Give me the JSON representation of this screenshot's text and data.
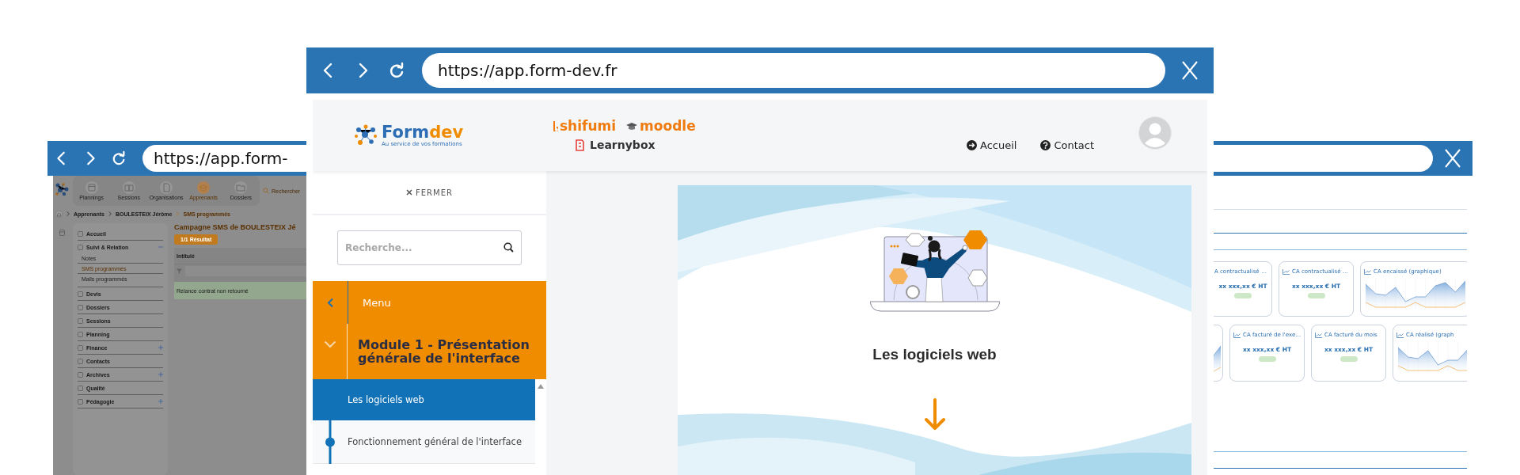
{
  "back_window": {
    "url": "https://app.form-",
    "app": {
      "toolbar": [
        {
          "label": "Plannings",
          "selected": false
        },
        {
          "label": "Sessions",
          "selected": false
        },
        {
          "label": "Organisations",
          "selected": false
        },
        {
          "label": "Apprenants",
          "selected": true
        },
        {
          "label": "Dossiers",
          "selected": false
        }
      ],
      "search": {
        "placeholder": "Rechercher"
      },
      "breadcrumb": [
        "Apprenants",
        "BOULESTEIX Jérôme",
        "SMS programmés"
      ],
      "menu": [
        {
          "label": "Accueil"
        },
        {
          "label": "Suivi & Relation",
          "expanded": true,
          "children": [
            {
              "label": "Notes",
              "selected": false
            },
            {
              "label": "SMS programmés",
              "selected": true
            },
            {
              "label": "Mails programmés",
              "selected": false
            }
          ]
        },
        {
          "label": "Devis"
        },
        {
          "label": "Dossiers"
        },
        {
          "label": "Sessions"
        },
        {
          "label": "Planning"
        },
        {
          "label": "Finance",
          "expanded": false
        },
        {
          "label": "Contacts"
        },
        {
          "label": "Archives",
          "expanded": false
        },
        {
          "label": "Qualité"
        },
        {
          "label": "Pédagogie",
          "expanded": false
        }
      ],
      "title": "Campagne SMS de BOULESTEIX Jé",
      "result_button": "1/1 Résultat",
      "table": {
        "columns": [
          "Intitulé"
        ],
        "rows": [
          [
            "Relance contrat non retourné"
          ]
        ]
      }
    },
    "dashboard": {
      "card_strips": [
        {
          "cards": [
            {
              "kind": "stat",
              "title": "A contractualisé …",
              "value": "xx xxx,xx € HT"
            },
            {
              "kind": "stat",
              "title": "CA contractualisé …",
              "value": "xx xxx,xx € HT"
            },
            {
              "kind": "chart",
              "title": "CA encaissé (graphique)"
            }
          ]
        },
        {
          "cards": [
            {
              "kind": "chart"
            },
            {
              "kind": "stat",
              "title": "CA facturé de l'exe…",
              "value": "xx xxx,xx € HT"
            },
            {
              "kind": "stat",
              "title": "CA facturé du mois",
              "value": "xx xxx,xx € HT"
            },
            {
              "kind": "chart",
              "title": "CA réalisé (graph"
            }
          ]
        }
      ]
    }
  },
  "front_window": {
    "url": "https://app.form-dev.fr",
    "header": {
      "wordmark": [
        "Form",
        "dev"
      ],
      "tagline": "Au service de vos formations",
      "brands": [
        {
          "label": "shifumi",
          "kind": "swirl"
        },
        {
          "label": "moodle",
          "kind": "hat"
        },
        {
          "label": "Learnybox",
          "kind": "book"
        }
      ],
      "nav": [
        {
          "label": "Accueil",
          "kind": "arrow"
        },
        {
          "label": "Contact",
          "kind": "question"
        }
      ]
    },
    "sidebar": {
      "close_label": "FERMER",
      "search": {
        "placeholder": "Recherche..."
      },
      "menu_label": "Menu",
      "module": {
        "title": "Module 1 - Présentation générale de l'interface",
        "expanded": true
      },
      "lessons": [
        {
          "label": "Les logiciels web",
          "selected": true
        },
        {
          "label": "Fonctionnement général de l'interface",
          "selected": false
        }
      ]
    },
    "content": {
      "title": "Les logiciels web"
    }
  }
}
